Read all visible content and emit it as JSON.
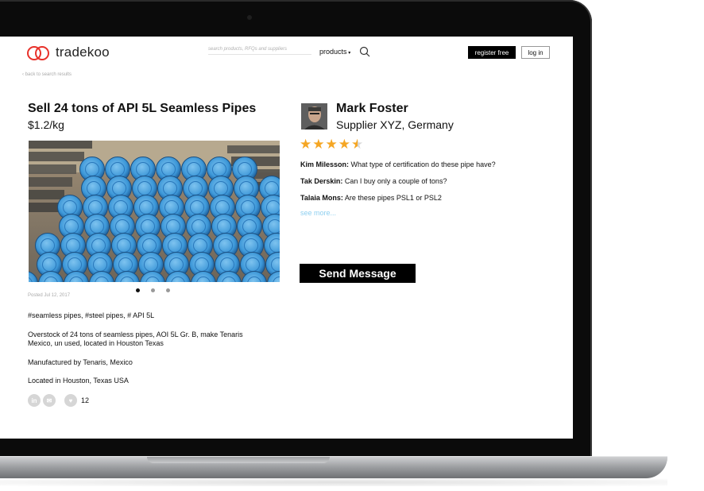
{
  "header": {
    "logo_text": "tradekoo",
    "search_placeholder": "search products, RFQs and suppliers",
    "products_label": "products",
    "register_label": "register free",
    "login_label": "log in",
    "back_link": "‹ back to search results",
    "accent_color": "#e8312a"
  },
  "listing": {
    "title": "Sell 24 tons of API 5L Seamless Pipes",
    "price": "$1.2/kg",
    "posted": "Posted Jul 12, 2017",
    "tags": "#seamless pipes, #steel pipes, # API 5L",
    "description": "Overstock of 24 tons of seamless pipes, AOI 5L Gr. B, make Tenaris Mexico, un used, located in Houston Texas",
    "manufacturer": "Manufactured by Tenaris, Mexico",
    "location": "Located in Houston, Texas USA",
    "carousel_active_index": 0,
    "carousel_count": 3,
    "likes": "12",
    "social_icons": [
      "linkedin-icon",
      "email-icon",
      "heart-icon"
    ]
  },
  "seller": {
    "name": "Mark Foster",
    "company": "Supplier XYZ, Germany",
    "rating": 4.5,
    "rating_max": 5
  },
  "comments": [
    {
      "author": "Kim Milesson:",
      "text": " What type of certification do these pipe have?"
    },
    {
      "author": "Tak Derskin:",
      "text": " Can I buy only a couple of tons?"
    },
    {
      "author": "Talaia Mons:",
      "text": " Are these pipes PSL1 or PSL2"
    }
  ],
  "see_more": "see more...",
  "send_button": "Send Message"
}
